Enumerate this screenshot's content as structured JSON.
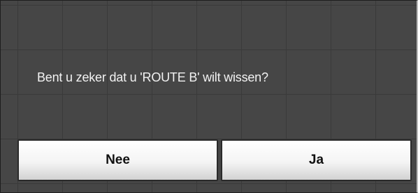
{
  "dialog": {
    "message": "Bent u zeker dat u 'ROUTE B' wilt wissen?",
    "buttons": {
      "no_label": "Nee",
      "yes_label": "Ja"
    }
  },
  "colors": {
    "dialog_background": "#464646",
    "grid_lines": "#3a3a3a",
    "text": "#f2f2f2",
    "button_face": "#f4f4f4"
  }
}
